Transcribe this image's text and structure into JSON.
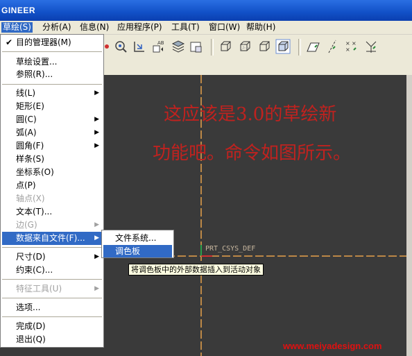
{
  "window": {
    "title": "GINEER"
  },
  "menubar": [
    {
      "label": "草绘(S)",
      "active": true
    },
    {
      "label": "分析(A)"
    },
    {
      "label": "信息(N)"
    },
    {
      "label": "应用程序(P)"
    },
    {
      "label": "工具(T)"
    },
    {
      "label": "窗口(W)"
    },
    {
      "label": "帮助(H)"
    }
  ],
  "sketch_menu": {
    "items": [
      {
        "label": "目的管理器(M)",
        "checked": true
      },
      {
        "label": "草绘设置..."
      },
      {
        "label": "参照(R)..."
      },
      {
        "label": "线(L)",
        "submenu": true
      },
      {
        "label": "矩形(E)"
      },
      {
        "label": "圆(C)",
        "submenu": true
      },
      {
        "label": "弧(A)",
        "submenu": true
      },
      {
        "label": "圆角(F)",
        "submenu": true
      },
      {
        "label": "样条(S)"
      },
      {
        "label": "坐标系(O)"
      },
      {
        "label": "点(P)"
      },
      {
        "label": "轴点(X)",
        "disabled": true
      },
      {
        "label": "文本(T)..."
      },
      {
        "label": "边(G)",
        "submenu": true,
        "disabled": true
      },
      {
        "label": "数据来自文件(F)...",
        "submenu": true,
        "highlighted": true
      },
      {
        "label": "尺寸(D)",
        "submenu": true
      },
      {
        "label": "约束(C)..."
      },
      {
        "label": "特征工具(U)",
        "submenu": true,
        "disabled": true
      },
      {
        "label": "选项..."
      },
      {
        "label": "完成(D)"
      },
      {
        "label": "退出(Q)"
      }
    ]
  },
  "data_from_file_submenu": {
    "items": [
      {
        "label": "文件系统..."
      },
      {
        "label": "调色板",
        "highlighted": true
      }
    ]
  },
  "tooltip": {
    "text": "将调色板中的外部数据插入到活动对象"
  },
  "annotation": {
    "line1": "这应该是3.0的草绘新",
    "line2": "功能吧。命令如图所示。"
  },
  "canvas": {
    "csys_label": "PRT_CSYS_DEF",
    "background": "#3a3a3a",
    "axis_color": "#e8a24a"
  },
  "watermark": {
    "text": "www.meiyadesign.com"
  },
  "toolbar": {
    "icons": [
      "sketch-tool-icon",
      "refit-icon",
      "reorient-icon",
      "view-list-icon",
      "layers-icon",
      "saved-view-icon",
      "wireframe-icon",
      "hidden-line-icon",
      "no-hidden-icon",
      "shading-icon",
      "datum-plane-icon",
      "datum-axis-icon",
      "datum-point-icon",
      "csys-display-icon"
    ]
  },
  "colors": {
    "menu_highlight": "#316ac5",
    "annotation": "#c0221f",
    "watermark": "#e01010"
  }
}
